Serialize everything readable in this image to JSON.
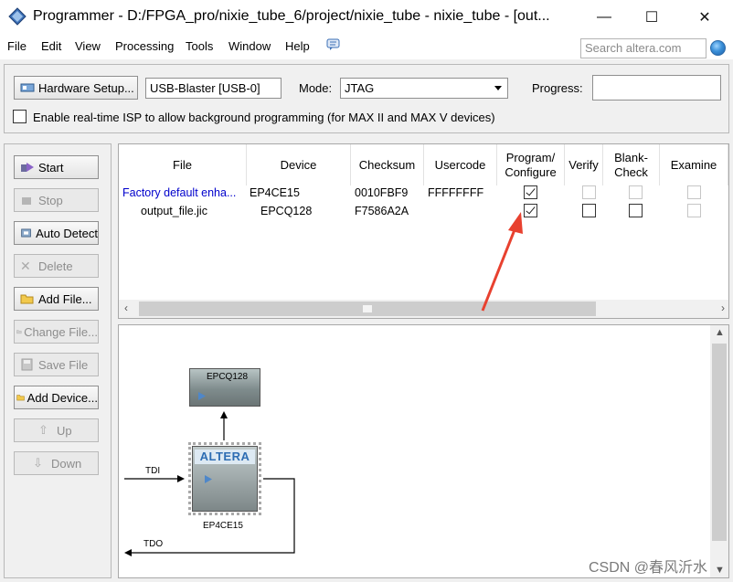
{
  "window": {
    "title": "Programmer - D:/FPGA_pro/nixie_tube_6/project/nixie_tube - nixie_tube - [out...",
    "minimize": "—",
    "maximize": "☐",
    "close": "✕"
  },
  "menu": {
    "items": [
      "File",
      "Edit",
      "View",
      "Processing",
      "Tools",
      "Window",
      "Help"
    ],
    "search_placeholder": "Search altera.com"
  },
  "toolbar": {
    "hardware_setup": "Hardware Setup...",
    "hardware_value": "USB-Blaster [USB-0]",
    "mode_label": "Mode:",
    "mode_value": "JTAG",
    "progress_label": "Progress:",
    "isp_label": "Enable real-time ISP to allow background programming (for MAX II and MAX V devices)"
  },
  "side_buttons": {
    "start": "Start",
    "stop": "Stop",
    "auto_detect": "Auto Detect",
    "delete": "Delete",
    "add_file": "Add File...",
    "change_file": "Change File...",
    "save_file": "Save File",
    "add_device": "Add Device...",
    "up": "Up",
    "down": "Down"
  },
  "table": {
    "headers": {
      "file": "File",
      "device": "Device",
      "checksum": "Checksum",
      "usercode": "Usercode",
      "program": "Program/ Configure",
      "verify": "Verify",
      "blank": "Blank- Check",
      "examine": "Examine"
    },
    "rows": [
      {
        "file": "Factory default enha...",
        "device": "EP4CE15",
        "checksum": "0010FBF9",
        "usercode": "FFFFFFFF",
        "program": true,
        "verify": false,
        "blank": false,
        "examine": false
      },
      {
        "file": "output_file.jic",
        "device": "EPCQ128",
        "checksum": "F7586A2A",
        "usercode": "",
        "program": true,
        "verify": false,
        "blank": false,
        "examine": false
      }
    ]
  },
  "diagram": {
    "flash_label": "EPCQ128",
    "fpga_label": "EP4CE15",
    "fpga_logo": "ALTERA",
    "tdi": "TDI",
    "tdo": "TDO"
  },
  "colors": {
    "annotation_arrow": "#e8412f",
    "link_text": "#0000cc"
  },
  "watermark": "CSDN @春风沂水"
}
